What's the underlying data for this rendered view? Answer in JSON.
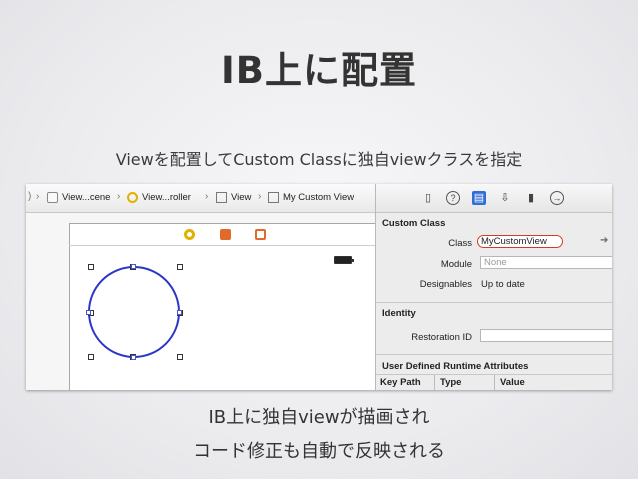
{
  "slide": {
    "title": "IB上に配置",
    "subtitle": "Viewを配置してCustom Classに独自viewクラスを指定",
    "footer_line1": "IB上に独自viewが描画され",
    "footer_line2": "コード修正も自動で反映される"
  },
  "jump_bar": {
    "items": [
      "View...cene",
      "View...roller",
      "View",
      "My Custom View"
    ]
  },
  "inspector": {
    "custom_class": {
      "header": "Custom Class",
      "class_label": "Class",
      "class_value": "MyCustomView",
      "module_label": "Module",
      "module_placeholder": "None",
      "designables_label": "Designables",
      "designables_value": "Up to date"
    },
    "identity": {
      "header": "Identity",
      "restoration_label": "Restoration ID",
      "restoration_value": ""
    },
    "runtime_attributes": {
      "header": "User Defined Runtime Attributes",
      "columns": [
        "Key Path",
        "Type",
        "Value"
      ]
    }
  },
  "colors": {
    "highlight_ring": "#d43a2a",
    "circle_stroke": "#2a35c7",
    "scene_dock_yellow": "#e2b100",
    "scene_dock_orange": "#e06a2a"
  }
}
